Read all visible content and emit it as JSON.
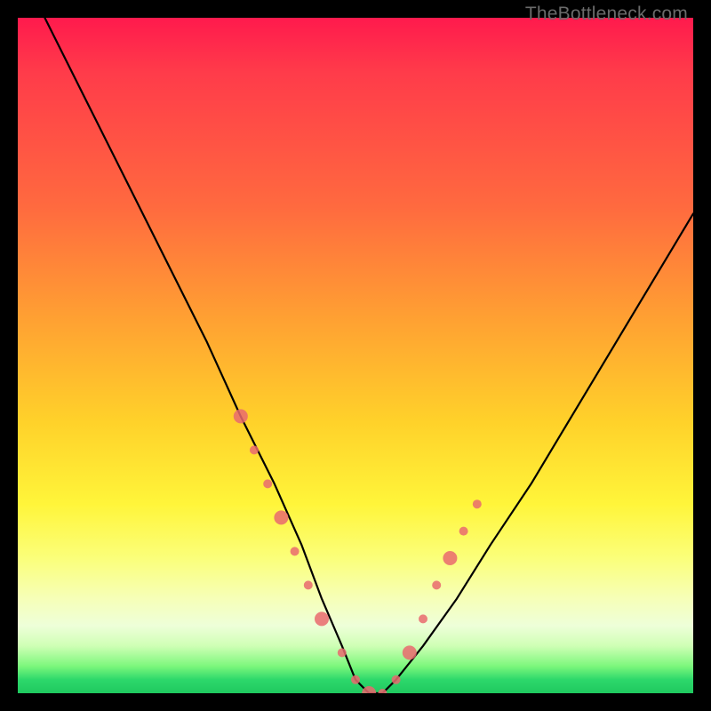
{
  "watermark": "TheBottleneck.com",
  "chart_data": {
    "type": "line",
    "title": "",
    "xlabel": "",
    "ylabel": "",
    "xlim": [
      0,
      100
    ],
    "ylim": [
      0,
      100
    ],
    "series": [
      {
        "name": "curve",
        "x": [
          4,
          10,
          16,
          22,
          28,
          33,
          38,
          42,
          45,
          48,
          50,
          52,
          54,
          56,
          60,
          65,
          70,
          76,
          82,
          88,
          94,
          100
        ],
        "values": [
          100,
          88,
          76,
          64,
          52,
          41,
          31,
          22,
          14,
          7,
          2,
          0,
          0,
          2,
          7,
          14,
          22,
          31,
          41,
          51,
          61,
          71
        ]
      }
    ],
    "markers": {
      "name": "highlight-dots",
      "color": "#e96a6f",
      "x": [
        33,
        35,
        37,
        39,
        41,
        43,
        45,
        48,
        50,
        52,
        54,
        56,
        58,
        60,
        62,
        64,
        66,
        68
      ],
      "values": [
        41,
        36,
        31,
        26,
        21,
        16,
        11,
        6,
        2,
        0,
        0,
        2,
        6,
        11,
        16,
        20,
        24,
        28
      ]
    }
  }
}
